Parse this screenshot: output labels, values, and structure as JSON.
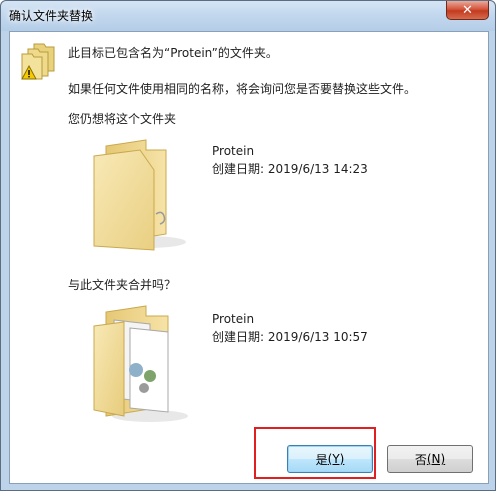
{
  "window": {
    "title": "确认文件夹替换",
    "close_label": "✕"
  },
  "message": {
    "line1": "此目标已包含名为“Protein”的文件夹。",
    "line2": "如果任何文件使用相同的名称，将会询问您是否要替换这些文件。",
    "line3": "您仍想将这个文件夹",
    "line4": "与此文件夹合并吗？"
  },
  "destination_folder": {
    "name": "Protein",
    "created": "创建日期: 2019/6/13 14:23",
    "icon": "empty-folder-icon"
  },
  "source_folder": {
    "name": "Protein",
    "created": "创建日期: 2019/6/13 10:57",
    "icon": "folder-with-files-icon"
  },
  "buttons": {
    "yes_label": "是",
    "yes_key": "(Y)",
    "no_label": "否",
    "no_key": "(N)"
  },
  "colors": {
    "highlight_box": "#e02020",
    "title_bar": "#c3d8ee",
    "close_button": "#c23a1f"
  }
}
